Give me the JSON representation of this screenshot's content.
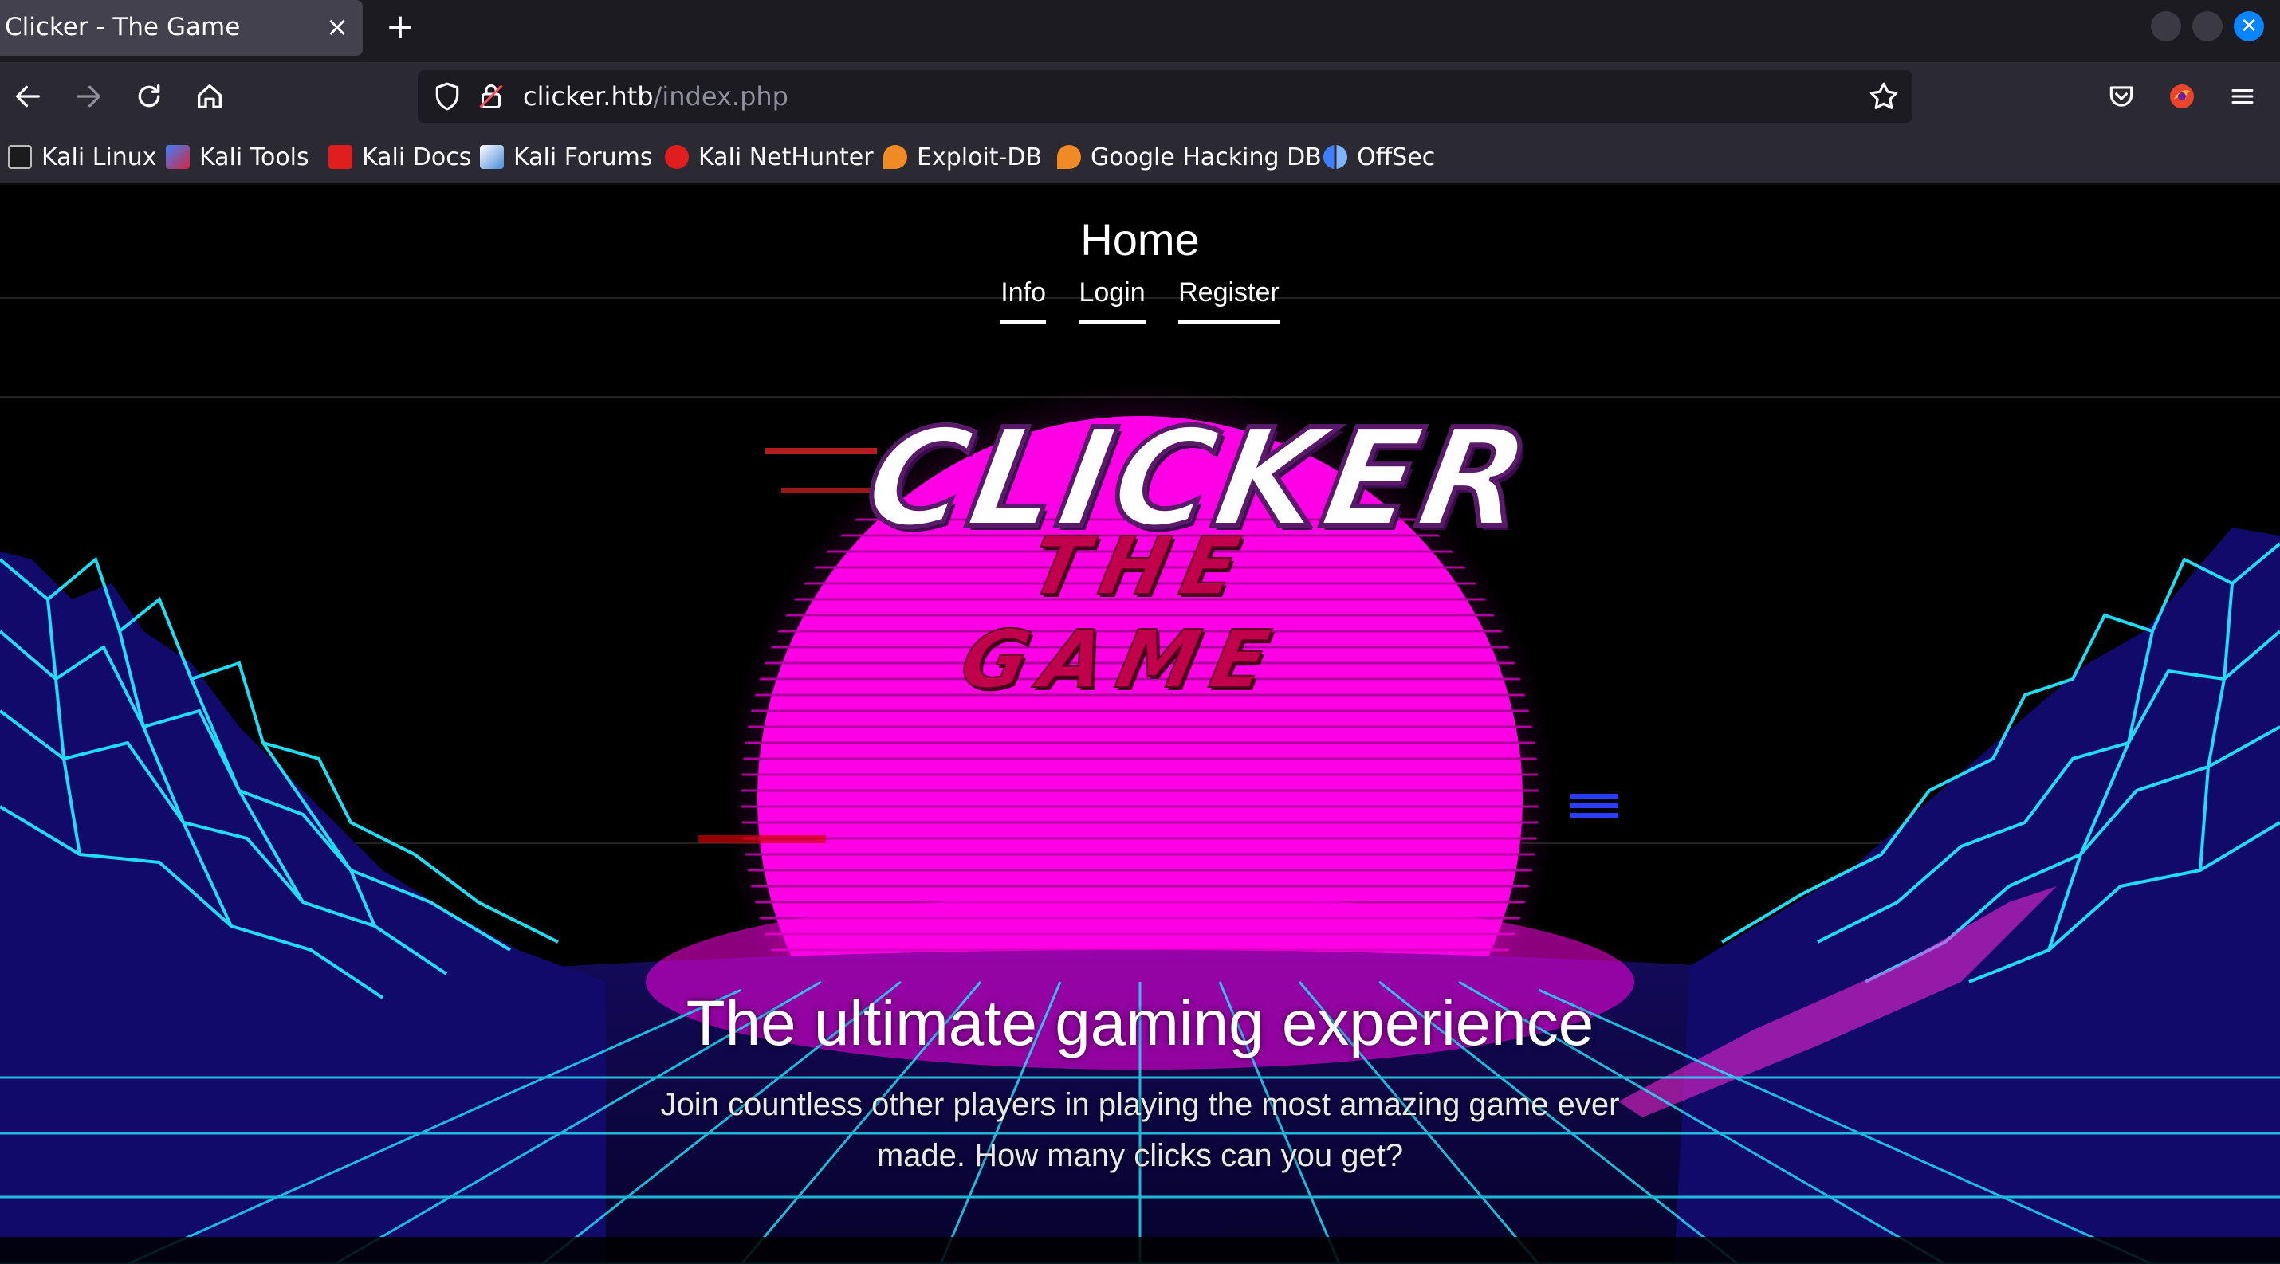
{
  "browser": {
    "tab_title": "Clicker - The Game",
    "tab_close": "×",
    "new_tab": "+",
    "url_host": "clicker.htb",
    "url_path": "/index.php",
    "window_close": "✕",
    "bookmarks": [
      {
        "label": "Kali Linux",
        "color": "#2a2a2a"
      },
      {
        "label": "Kali Tools",
        "color": "#d7263d"
      },
      {
        "label": "Kali Docs",
        "color": "#e01e1e"
      },
      {
        "label": "Kali Forums",
        "color": "#4b8bd9"
      },
      {
        "label": "Kali NetHunter",
        "color": "#e01e1e"
      },
      {
        "label": "Exploit-DB",
        "color": "#f08a24"
      },
      {
        "label": "Google Hacking DB",
        "color": "#f08a24"
      },
      {
        "label": "OffSec",
        "color": "#3d7fff"
      }
    ]
  },
  "page": {
    "heading": "Home",
    "nav": [
      "Info",
      "Login",
      "Register"
    ],
    "logo_line1": "CLICKER",
    "logo_line2": "THE GAME",
    "hero_title": "The ultimate gaming experience",
    "hero_subtitle_line1": "Join countless other players in playing the most amazing game ever",
    "hero_subtitle_line2": "made. How many clicks can you get?"
  },
  "colors": {
    "sun": "#ff00e6",
    "grid": "#21e8ff",
    "mountain_dark": "#1a1480",
    "tab_active": "#42414d",
    "toolbar": "#2b2a33",
    "accent": "#0a84ff"
  },
  "icons": [
    "back-arrow-icon",
    "forward-arrow-icon",
    "reload-icon",
    "home-icon",
    "shield-icon",
    "lock-icon",
    "star-icon",
    "pocket-icon",
    "extension-icon",
    "menu-icon"
  ]
}
